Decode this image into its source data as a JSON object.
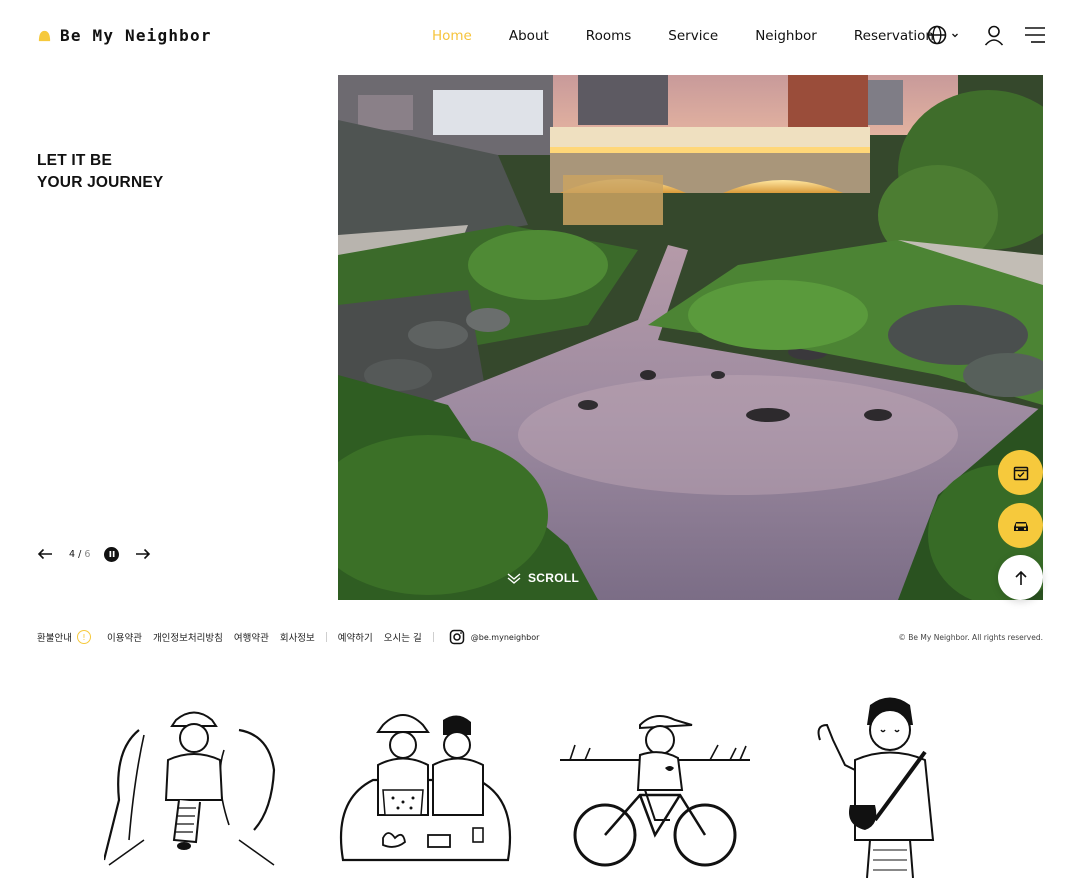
{
  "brand": {
    "name": "Be My Neighbor",
    "accent": "#f6c93c"
  },
  "nav": {
    "items": [
      {
        "label": "Home",
        "active": true
      },
      {
        "label": "About"
      },
      {
        "label": "Rooms"
      },
      {
        "label": "Service"
      },
      {
        "label": "Neighbor"
      },
      {
        "label": "Reservation"
      }
    ]
  },
  "header_icons": [
    "globe-icon",
    "chevron-down-icon",
    "user-icon",
    "menu-icon"
  ],
  "hero": {
    "title_line1": "LET IT BE",
    "title_line2": "YOUR JOURNEY",
    "scroll_label": "SCROLL"
  },
  "slider": {
    "current": "4",
    "separator": "/",
    "total": "6"
  },
  "fab": [
    "calendar-icon",
    "car-icon",
    "arrow-up-icon"
  ],
  "footer": {
    "links": [
      "환불안내",
      "이용약관",
      "개인정보처리방침",
      "여행약관",
      "회사정보",
      "예약하기",
      "오시는 길"
    ],
    "refund_badge": "!",
    "instagram": "@be.myneighbor",
    "copyright": "© Be My Neighbor. All rights reserved."
  }
}
